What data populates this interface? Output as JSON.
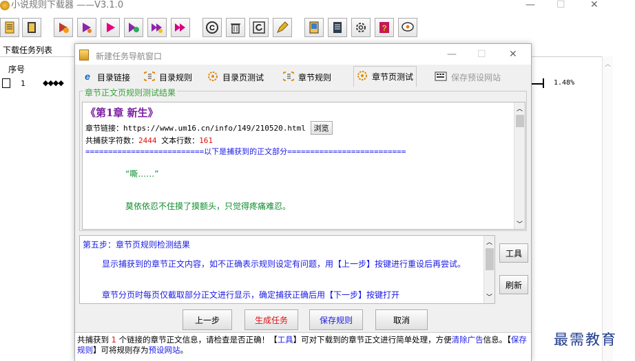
{
  "app": {
    "title": "小说规则下载器  ——V3.1.0",
    "window_controls": {
      "minimize": "—",
      "maximize": "☐",
      "close": "✕"
    }
  },
  "toolbar_icons": [
    "list-icon",
    "book-icon",
    "play-start-icon",
    "play-icon",
    "play-red-icon",
    "play-gear-icon",
    "fast-forward-icon",
    "skip-forward-icon",
    "c-icon",
    "trash-icon",
    "refresh-icon",
    "pen-icon",
    "document-icon",
    "notebook-icon",
    "gear-icon",
    "help-icon",
    "chat-icon"
  ],
  "task_panel": {
    "label": "下载任务列表",
    "column_header": "序号",
    "rows": [
      {
        "num": "1",
        "marker": "◆◆◆◆",
        "progress": "1.48%"
      }
    ]
  },
  "dialog": {
    "title": "新建任务导航窗口",
    "window_controls": {
      "minimize": "—",
      "maximize": "☐",
      "close": "✕"
    },
    "tabs": [
      {
        "label": "目录链接",
        "icon": "ie-icon"
      },
      {
        "label": "目录规则",
        "icon": "list-rule-icon"
      },
      {
        "label": "目录页测试",
        "icon": "gear-test-icon"
      },
      {
        "label": "章节规则",
        "icon": "chapter-rule-icon"
      },
      {
        "label": "章节页测试",
        "icon": "gear-test-icon",
        "active": true
      },
      {
        "label": "保存预设网站",
        "icon": "save-keyboard-icon",
        "disabled": true
      }
    ],
    "result_group_label": "章节正文页规则测试结果",
    "result": {
      "chapter_title": "《第1章  新生》",
      "link_label": "章节链接：",
      "link_url": "https://www.um16.cn/info/149/210520.html",
      "browse_label": "浏览",
      "count_prefix": "共捕获字符数：",
      "char_count": "2444",
      "lines_prefix": " 文本行数：",
      "line_count": "161",
      "separator": "==========================以下是捕获到的正文部分==========================",
      "body_lines": [
        "“嘶……”",
        "莫依依忍不住摸了摸额头，只觉得疼痛难忍。"
      ]
    },
    "step": {
      "title": "第五步：章节页规则检测结果",
      "text1": "显示捕获到的章节正文内容，如不正确表示规则设定有问题，用【上一步】按键进行重设后再尝试。",
      "text2": "章节分页时每页仅截取部分正文进行显示，确定捕获正确后用【下一步】按键打开"
    },
    "side_buttons": {
      "tools": "工具",
      "refresh": "刷新"
    },
    "buttons": {
      "prev": "上一步",
      "generate": "生成任务",
      "save": "保存规则",
      "cancel": "取消"
    },
    "status": {
      "p1": "共捕获到 ",
      "count": "1",
      "p2": " 个链接的章节正文信息，请检查是否正确！【",
      "tools": "工具",
      "p3": "】可对下载到的章节正文进行简单处理，方便",
      "clean": "清除广告",
      "p4": "信息。【",
      "save": "保存规则",
      "p5": "】可将规则存为",
      "preset": "预设网站",
      "p6": "。"
    }
  },
  "watermark": "最需教育",
  "colors": {
    "accent_green": "#3aa03a",
    "link_blue": "#1a1ae6",
    "alert_red": "#e01010",
    "chapter_purple": "#7b1fa2"
  }
}
